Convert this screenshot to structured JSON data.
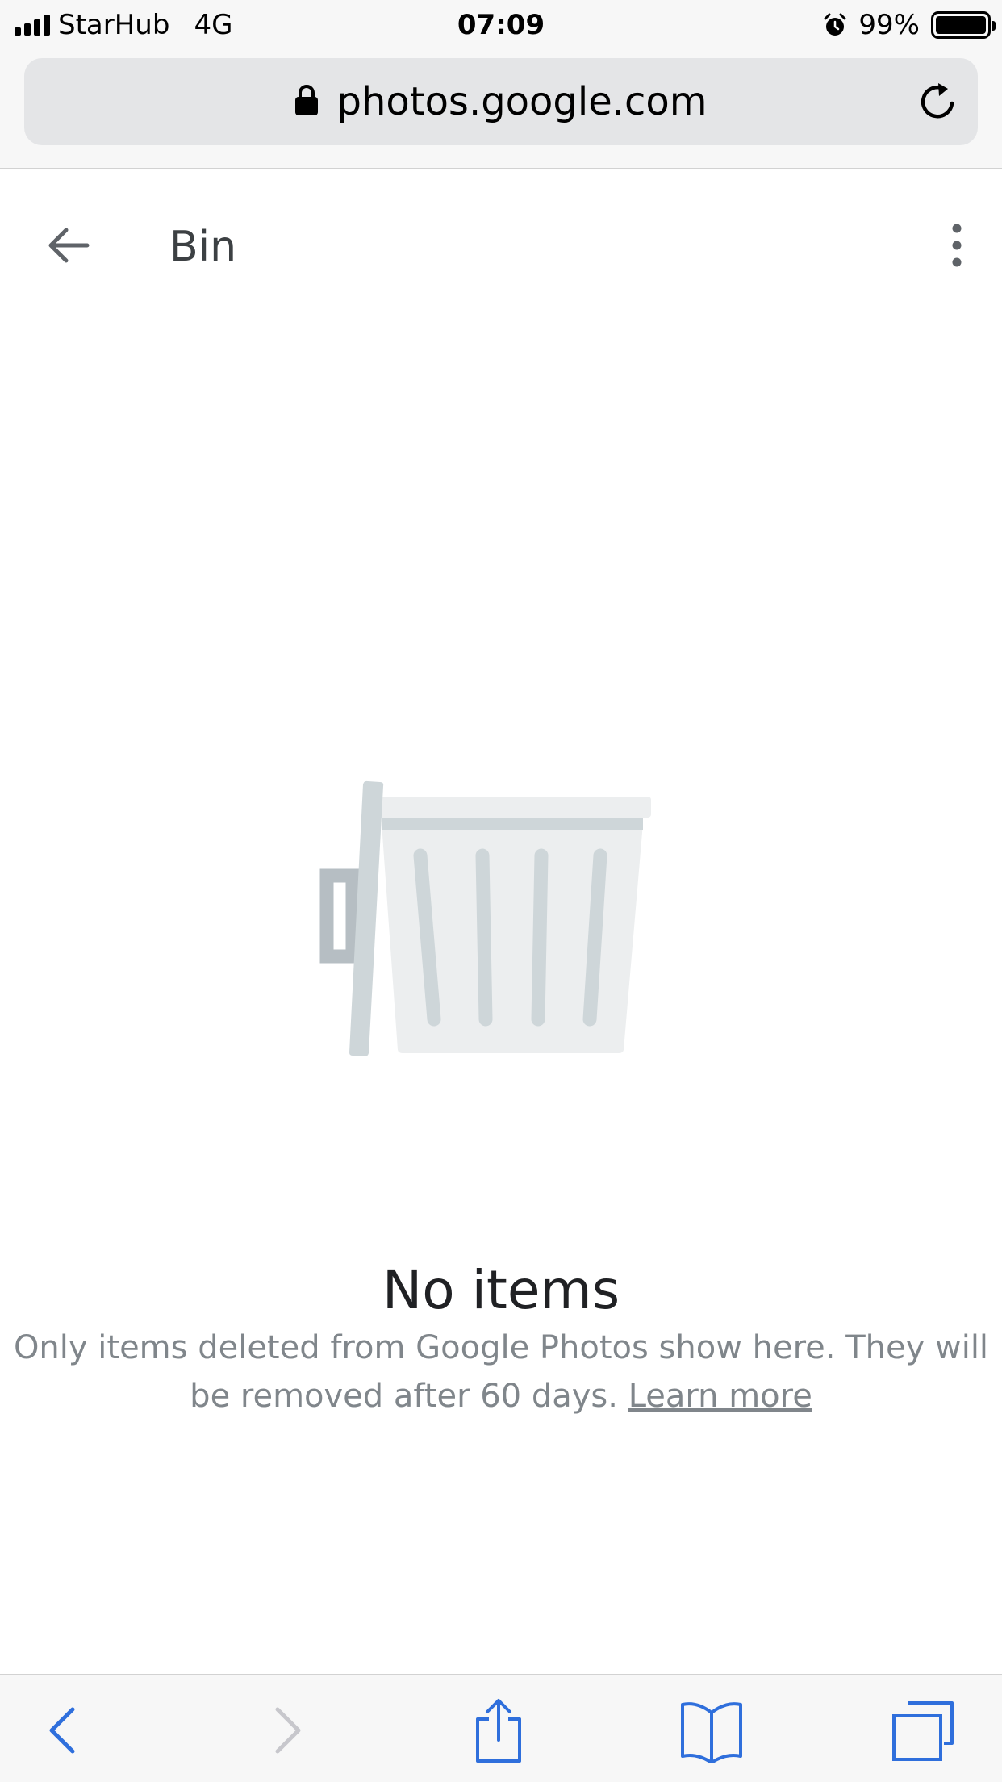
{
  "status_bar": {
    "carrier": "StarHub",
    "network": "4G",
    "time": "07:09",
    "battery": "99%"
  },
  "url_bar": {
    "url": "photos.google.com"
  },
  "header": {
    "title": "Bin"
  },
  "empty_state": {
    "title": "No items",
    "description": "Only items deleted from Google Photos show here. They will be removed after 60 days.",
    "learn_more": "Learn more"
  },
  "colors": {
    "toolbar_active": "#2f6fdc",
    "toolbar_disabled": "#c7c7cc",
    "illustration_light": "#eceeef",
    "illustration_mid": "#ced6d9",
    "illustration_dark": "#b6bec3"
  },
  "icons": {
    "back": "arrow-back-icon",
    "more": "more-vert-icon",
    "lock": "lock-icon",
    "reload": "reload-icon",
    "toolbar": [
      "chevron-left-icon",
      "chevron-right-icon",
      "share-icon",
      "bookmarks-icon",
      "tabs-icon"
    ]
  }
}
